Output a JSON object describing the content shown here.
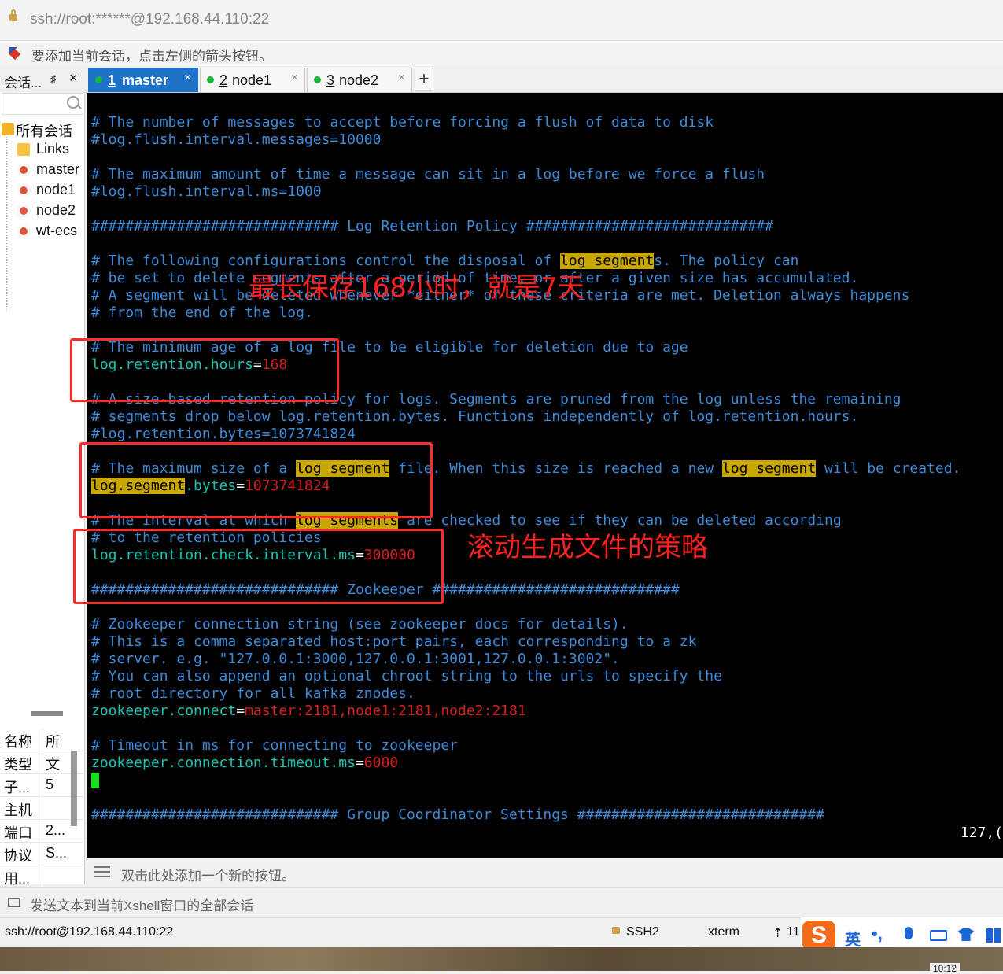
{
  "window": {
    "address": "ssh://root:******@192.168.44.110:22",
    "hint": "要添加当前会话，点击左侧的箭头按钮。"
  },
  "sidebar": {
    "title": "会话...",
    "pin": "♯",
    "close": "×",
    "tree": [
      {
        "label": "所有会话",
        "icon": "folder-open-icon"
      },
      {
        "label": "Links",
        "icon": "folder-icon"
      },
      {
        "label": "master",
        "icon": "session-icon"
      },
      {
        "label": "node1",
        "icon": "session-icon"
      },
      {
        "label": "node2",
        "icon": "session-icon"
      },
      {
        "label": "wt-ecs",
        "icon": "session-icon"
      }
    ],
    "properties": [
      {
        "key": "名称",
        "value": "所"
      },
      {
        "key": "类型",
        "value": "文"
      },
      {
        "key": "子...",
        "value": "5"
      },
      {
        "key": "主机",
        "value": ""
      },
      {
        "key": "端口",
        "value": "2..."
      },
      {
        "key": "协议",
        "value": "S..."
      },
      {
        "key": "用...",
        "value": ""
      }
    ]
  },
  "tabs": [
    {
      "num": "1",
      "name": "master",
      "active": true,
      "close": "×"
    },
    {
      "num": "2",
      "name": "node1",
      "active": false,
      "close": "×"
    },
    {
      "num": "3",
      "name": "node2",
      "active": false,
      "close": "×"
    }
  ],
  "tab_add": "+",
  "terminal": {
    "lines": {
      "l01": "# The number of messages to accept before forcing a flush of data to disk",
      "l02": "#log.flush.interval.messages=10000",
      "l03": "# The maximum amount of time a message can sit in a log before we force a flush",
      "l04": "#log.flush.interval.ms=1000",
      "l05a": "############################# ",
      "l05b": "Log Retention Policy",
      "l05c": " #############################",
      "l06a": "# The following configurations control the disposal of ",
      "l06b": "log segment",
      "l06c": "s. The policy can",
      "l07": "# be set to delete segments after a period of time, or after a given size has accumulated.",
      "l08": "# A segment will be deleted whenever *either* of these criteria are met. Deletion always happens",
      "l09": "# from the end of the log.",
      "l10": "# The minimum age of a log file to be eligible for deletion due to age",
      "l11a": "log.retention.hours",
      "l11b": "=",
      "l11c": "168",
      "l12": "# A size-based retention policy for logs. Segments are pruned from the log unless the remaining",
      "l13": "# segments drop below log.retention.bytes. Functions independently of log.retention.hours.",
      "l14": "#log.retention.bytes=1073741824",
      "l15a": "# The maximum size of a ",
      "l15b": "log segment",
      "l15c": " file. When this size is reached a new ",
      "l15d": "log segment",
      "l15e": " will be created.",
      "l16a": "log.segment",
      "l16b": ".bytes",
      "l16c": "=",
      "l16d": "1073741824",
      "l17a": "# The interval at which ",
      "l17b": "log segments",
      "l17c": " are checked to see if they can be deleted according",
      "l18": "# to the retention policies",
      "l19a": "log.retention.check.interval.ms",
      "l19b": "=",
      "l19c": "300000",
      "l20a": "############################# ",
      "l20b": "Zookeeper",
      "l20c": " #############################",
      "l21": "# Zookeeper connection string (see zookeeper docs for details).",
      "l22": "# This is a comma separated host:port pairs, each corresponding to a zk",
      "l23": "# server. e.g. \"127.0.0.1:3000,127.0.0.1:3001,127.0.0.1:3002\".",
      "l24": "# You can also append an optional chroot string to the urls to specify the",
      "l25": "# root directory for all kafka znodes.",
      "l26a": "zookeeper.connect",
      "l26b": "=",
      "l26c": "master:2181,node1:2181,node2:2181",
      "l27": "# Timeout in ms for connecting to zookeeper",
      "l28a": "zookeeper.connection.timeout.ms",
      "l28b": "=",
      "l28c": "6000",
      "l29a": "############################# ",
      "l29b": "Group Coordinator Settings",
      "l29c": " #############################"
    },
    "position": "127,("
  },
  "annotations": {
    "retention_note": "最长保存168小时，就是7天",
    "rolling_note": "滚动生成文件的策略"
  },
  "quickbar": "双击此处添加一个新的按钮。",
  "sendbar": "发送文本到当前Xshell窗口的全部会话",
  "status": {
    "address": "ssh://root@192.168.44.110:22",
    "protocol": "SSH2",
    "terminal": "xterm",
    "size_icon": "⇡",
    "size": "11"
  },
  "ime": {
    "logo": "S",
    "lang": "英",
    "punct": "•,"
  },
  "clock": "10:12",
  "colors": {
    "comment": "#3d8ad8",
    "key": "#18c5b1",
    "value": "#d4201e",
    "highlight": "#c8a700",
    "tab_active": "#1e72c8",
    "annotation": "#ff2a2a"
  }
}
